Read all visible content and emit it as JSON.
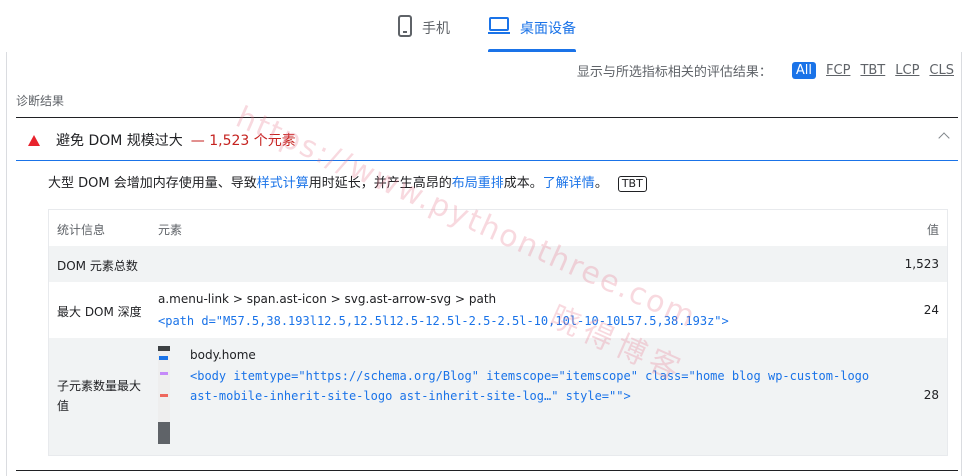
{
  "tabs": [
    {
      "label": "手机",
      "icon": "phone-icon"
    },
    {
      "label": "桌面设备",
      "icon": "monitor-icon"
    }
  ],
  "filter": {
    "label": "显示与所选指标相关的评估结果：",
    "chips": [
      "All",
      "FCP",
      "TBT",
      "LCP",
      "CLS"
    ],
    "active": "All"
  },
  "section_title": "诊断结果",
  "audit": {
    "title": "避免 DOM 规模过大",
    "display_value": "— 1,523 个元素",
    "desc_parts": [
      "大型 DOM 会增加内存使用量、导致",
      "样式计算",
      "用时延长，并产生高昂的",
      "布局重排",
      "成本。",
      "了解详情",
      "。"
    ],
    "badge": "TBT"
  },
  "table": {
    "headers": {
      "stat": "统计信息",
      "element": "元素",
      "value": "值"
    },
    "rows": [
      {
        "stat": "DOM 元素总数",
        "selector": "",
        "snippet": "",
        "value": "1,523"
      },
      {
        "stat": "最大 DOM 深度",
        "selector": "a.menu-link > span.ast-icon > svg.ast-arrow-svg > path",
        "snippet": "<path d=\"M57.5,38.193l12.5,12.5l12.5-12.5l-2.5-2.5l-10,10l-10-10L57.5,38.193z\">",
        "value": "24"
      },
      {
        "stat": "子元素数量最大值",
        "selector": "body.home",
        "snippet_line1": "<body itemtype=\"https://schema.org/Blog\" itemscope=\"itemscope\" class=\"home blog wp-custom-logo",
        "snippet_line2": "ast-mobile-inherit-site-logo ast-inherit-site-log…\" style=\"\">",
        "value": "28"
      }
    ]
  },
  "watermark": {
    "url": "https://www.pythonthree.com",
    "name": "晓得博客"
  }
}
